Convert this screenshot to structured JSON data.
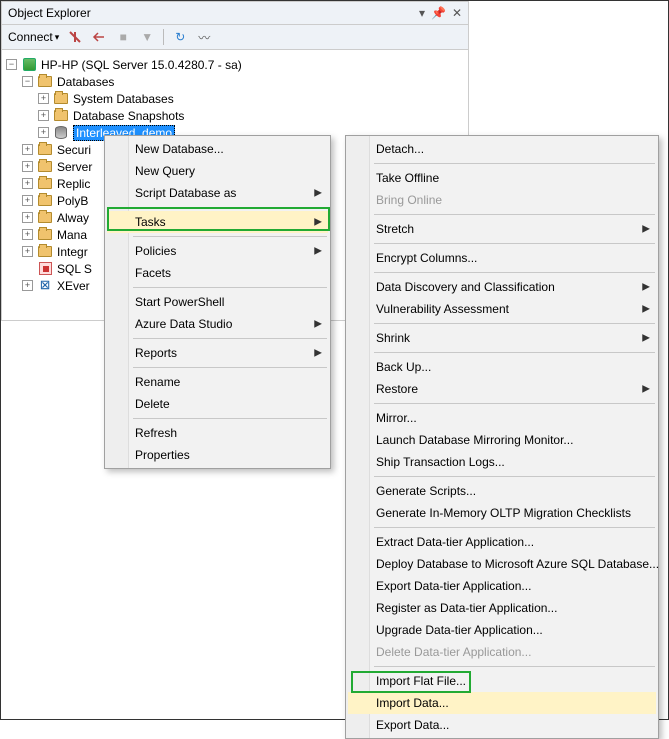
{
  "panel": {
    "title": "Object Explorer",
    "connect": "Connect"
  },
  "tree": {
    "server": "HP-HP (SQL Server 15.0.4280.7 - sa)",
    "databases": "Databases",
    "children": {
      "sysdb": "System Databases",
      "snapshots": "Database Snapshots",
      "selected": "Interleaved_demo"
    },
    "nodes": {
      "securi": "Securi",
      "server": "Server",
      "replic": "Replic",
      "polyb": "PolyB",
      "alway": "Alway",
      "mana": "Mana",
      "integr": "Integr",
      "sqls": "SQL S",
      "xever": "XEver"
    }
  },
  "menu1": {
    "newdb": "New Database...",
    "newquery": "New Query",
    "scriptdb": "Script Database as",
    "tasks": "Tasks",
    "policies": "Policies",
    "facets": "Facets",
    "startps": "Start PowerShell",
    "azure": "Azure Data Studio",
    "reports": "Reports",
    "rename": "Rename",
    "delete": "Delete",
    "refresh": "Refresh",
    "properties": "Properties"
  },
  "menu2": {
    "detach": "Detach...",
    "takeoffline": "Take Offline",
    "bringonline": "Bring Online",
    "stretch": "Stretch",
    "encrypt": "Encrypt Columns...",
    "discovery": "Data Discovery and Classification",
    "vuln": "Vulnerability Assessment",
    "shrink": "Shrink",
    "backup": "Back Up...",
    "restore": "Restore",
    "mirror": "Mirror...",
    "launchmirror": "Launch Database Mirroring Monitor...",
    "shiplogs": "Ship Transaction Logs...",
    "genscripts": "Generate Scripts...",
    "genmemory": "Generate In-Memory OLTP Migration Checklists",
    "extractdt": "Extract Data-tier Application...",
    "deployazure": "Deploy Database to Microsoft Azure SQL Database...",
    "exportdt": "Export Data-tier Application...",
    "registerdt": "Register as Data-tier Application...",
    "upgradedt": "Upgrade Data-tier Application...",
    "deletedt": "Delete Data-tier Application...",
    "importflat": "Import Flat File...",
    "importdata": "Import Data...",
    "exportdata": "Export Data..."
  }
}
